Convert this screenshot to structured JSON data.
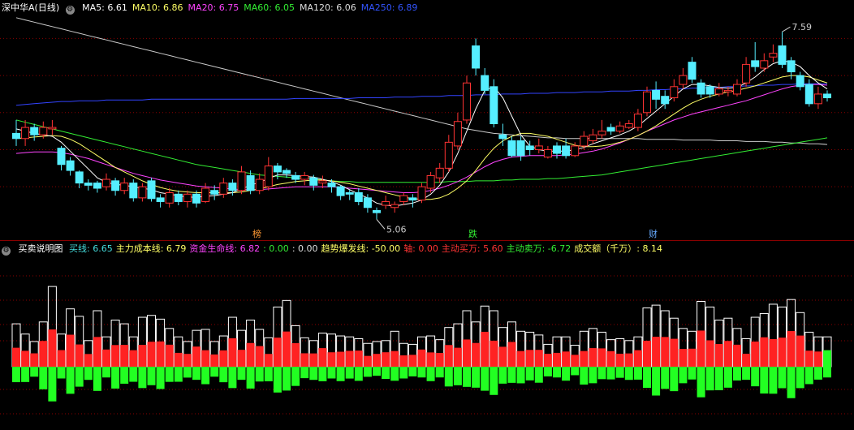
{
  "stock": {
    "title": "深中华A(日线)"
  },
  "ma_legend": [
    {
      "label": "MA5: 6.61",
      "color": "#ffffff"
    },
    {
      "label": "MA10: 6.86",
      "color": "#ffff66"
    },
    {
      "label": "MA20: 6.75",
      "color": "#ff44ff"
    },
    {
      "label": "MA60: 6.05",
      "color": "#33ee33"
    },
    {
      "label": "MA120: 6.06",
      "color": "#dddddd"
    },
    {
      "label": "MA250: 6.89",
      "color": "#3355ff"
    }
  ],
  "indicator": {
    "title": "买卖说明图",
    "items": [
      {
        "label": "买线: 6.65",
        "color": "#44dddd"
      },
      {
        "label": "主力成本线: 6.79",
        "color": "#ffff66"
      },
      {
        "label": "资金生命线: 6.82",
        "color": "#ff44ff"
      },
      {
        "label": ": 0.00",
        "color": "#33ee33"
      },
      {
        "label": ": 0.00",
        "color": "#dddddd"
      },
      {
        "label": "趋势爆发线: -50.00",
        "color": "#ffff66"
      },
      {
        "label": "轴: 0.00",
        "color": "#ff3333"
      },
      {
        "label": "主动买万: 5.60",
        "color": "#ff3333"
      },
      {
        "label": "主动卖万: -6.72",
        "color": "#33ee33"
      },
      {
        "label": "成交额（千万）: 8.14",
        "color": "#ffff66"
      }
    ]
  },
  "markers": [
    {
      "text": "榜",
      "color": "#ff9933"
    },
    {
      "text": "跌",
      "color": "#33ee33"
    },
    {
      "text": "财",
      "color": "#66aaff"
    }
  ],
  "colors": {
    "up": "#ff3333",
    "down": "#55eeff",
    "buy": "#ff2222",
    "sell": "#22ff22",
    "grid": "#8b0000"
  },
  "chart_data": [
    {
      "type": "candlestick",
      "annotations": [
        {
          "text": "7.59",
          "value": 7.59
        },
        {
          "text": "5.06",
          "value": 5.06
        }
      ],
      "ylim": [
        4.9,
        7.8
      ],
      "candles": [
        [
          6.22,
          6.15,
          6.4,
          6.05
        ],
        [
          6.15,
          6.3,
          6.4,
          6.05
        ],
        [
          6.3,
          6.2,
          6.35,
          6.12
        ],
        [
          6.2,
          6.3,
          6.38,
          6.15
        ],
        [
          6.28,
          6.3,
          6.4,
          6.2
        ],
        [
          6.02,
          5.8,
          6.05,
          5.72
        ],
        [
          5.85,
          5.72,
          5.9,
          5.65
        ],
        [
          5.7,
          5.55,
          5.72,
          5.48
        ],
        [
          5.55,
          5.52,
          5.6,
          5.45
        ],
        [
          5.55,
          5.48,
          5.58,
          5.42
        ],
        [
          5.5,
          5.6,
          5.68,
          5.45
        ],
        [
          5.58,
          5.45,
          5.62,
          5.38
        ],
        [
          5.45,
          5.55,
          5.62,
          5.4
        ],
        [
          5.55,
          5.35,
          5.6,
          5.3
        ],
        [
          5.35,
          5.5,
          5.55,
          5.3
        ],
        [
          5.58,
          5.34,
          5.62,
          5.3
        ],
        [
          5.35,
          5.3,
          5.4,
          5.22
        ],
        [
          5.28,
          5.42,
          5.48,
          5.22
        ],
        [
          5.4,
          5.3,
          5.45,
          5.25
        ],
        [
          5.3,
          5.4,
          5.45,
          5.22
        ],
        [
          5.4,
          5.28,
          5.45,
          5.22
        ],
        [
          5.3,
          5.48,
          5.55,
          5.28
        ],
        [
          5.45,
          5.4,
          5.52,
          5.32
        ],
        [
          5.4,
          5.55,
          5.62,
          5.35
        ],
        [
          5.55,
          5.45,
          5.6,
          5.38
        ],
        [
          5.45,
          5.7,
          5.78,
          5.4
        ],
        [
          5.65,
          5.45,
          5.72,
          5.4
        ],
        [
          5.45,
          5.6,
          5.68,
          5.4
        ],
        [
          5.5,
          5.78,
          5.9,
          5.45
        ],
        [
          5.78,
          5.7,
          5.82,
          5.6
        ],
        [
          5.72,
          5.68,
          5.75,
          5.62
        ],
        [
          5.65,
          5.6,
          5.7,
          5.55
        ],
        [
          5.6,
          5.65,
          5.7,
          5.52
        ],
        [
          5.62,
          5.52,
          5.66,
          5.45
        ],
        [
          5.55,
          5.58,
          5.65,
          5.48
        ],
        [
          5.55,
          5.5,
          5.6,
          5.42
        ],
        [
          5.5,
          5.38,
          5.52,
          5.32
        ],
        [
          5.42,
          5.4,
          5.46,
          5.32
        ],
        [
          5.42,
          5.3,
          5.48,
          5.25
        ],
        [
          5.35,
          5.22,
          5.4,
          5.15
        ],
        [
          5.18,
          5.15,
          5.22,
          5.06
        ],
        [
          5.25,
          5.3,
          5.38,
          5.2
        ],
        [
          5.22,
          5.26,
          5.3,
          5.15
        ],
        [
          5.3,
          5.38,
          5.42,
          5.25
        ],
        [
          5.35,
          5.32,
          5.4,
          5.22
        ],
        [
          5.32,
          5.5,
          5.55,
          5.28
        ],
        [
          5.48,
          5.65,
          5.7,
          5.42
        ],
        [
          5.62,
          5.75,
          5.82,
          5.55
        ],
        [
          5.75,
          6.1,
          6.2,
          5.7
        ],
        [
          6.05,
          6.38,
          6.5,
          6.0
        ],
        [
          6.4,
          6.9,
          7.0,
          6.35
        ],
        [
          7.4,
          7.1,
          7.5,
          7.0
        ],
        [
          7.0,
          6.8,
          7.1,
          6.75
        ],
        [
          6.85,
          6.35,
          6.95,
          6.3
        ],
        [
          6.2,
          6.15,
          6.35,
          6.05
        ],
        [
          6.12,
          5.92,
          6.18,
          5.9
        ],
        [
          6.12,
          5.92,
          6.18,
          5.85
        ],
        [
          6.05,
          6.0,
          6.12,
          5.92
        ],
        [
          6.0,
          6.05,
          6.15,
          5.95
        ],
        [
          5.9,
          6.0,
          6.05,
          5.88
        ],
        [
          6.05,
          5.95,
          6.1,
          5.88
        ],
        [
          6.05,
          5.92,
          6.15,
          5.88
        ],
        [
          5.92,
          6.05,
          6.1,
          5.9
        ],
        [
          6.05,
          6.18,
          6.25,
          6.0
        ],
        [
          6.12,
          6.2,
          6.28,
          6.08
        ],
        [
          6.2,
          6.25,
          6.4,
          6.15
        ],
        [
          6.3,
          6.25,
          6.35,
          6.2
        ],
        [
          6.25,
          6.32,
          6.38,
          6.22
        ],
        [
          6.3,
          6.35,
          6.4,
          6.28
        ],
        [
          6.3,
          6.48,
          6.55,
          6.25
        ],
        [
          6.5,
          6.78,
          6.85,
          6.45
        ],
        [
          6.8,
          6.68,
          6.92,
          6.55
        ],
        [
          6.72,
          6.62,
          6.8,
          6.55
        ],
        [
          6.7,
          6.85,
          6.95,
          6.65
        ],
        [
          6.88,
          7.0,
          7.1,
          6.82
        ],
        [
          7.18,
          6.95,
          7.25,
          6.9
        ],
        [
          6.9,
          6.75,
          6.95,
          6.7
        ],
        [
          6.85,
          6.75,
          6.88,
          6.7
        ],
        [
          6.75,
          6.82,
          6.9,
          6.72
        ],
        [
          6.78,
          6.8,
          6.85,
          6.72
        ],
        [
          6.75,
          6.88,
          6.95,
          6.72
        ],
        [
          6.9,
          7.15,
          7.25,
          6.85
        ],
        [
          7.2,
          7.12,
          7.45,
          7.05
        ],
        [
          7.1,
          7.2,
          7.3,
          7.05
        ],
        [
          7.25,
          7.3,
          7.42,
          7.18
        ],
        [
          7.4,
          7.15,
          7.59,
          7.1
        ],
        [
          7.2,
          7.05,
          7.25,
          6.95
        ],
        [
          7.0,
          6.85,
          7.05,
          6.8
        ],
        [
          6.88,
          6.62,
          6.95,
          6.58
        ],
        [
          6.62,
          6.75,
          6.85,
          6.55
        ],
        [
          6.75,
          6.7,
          6.8,
          6.65
        ]
      ],
      "ma": {
        "MA5": [
          6.28,
          6.25,
          6.22,
          6.2,
          6.18,
          6.1,
          5.98,
          5.86,
          5.74,
          5.62,
          5.56,
          5.53,
          5.52,
          5.5,
          5.48,
          5.46,
          5.42,
          5.4,
          5.38,
          5.36,
          5.36,
          5.37,
          5.38,
          5.4,
          5.42,
          5.47,
          5.52,
          5.56,
          5.61,
          5.66,
          5.66,
          5.65,
          5.64,
          5.63,
          5.6,
          5.57,
          5.52,
          5.46,
          5.4,
          5.35,
          5.28,
          5.25,
          5.24,
          5.26,
          5.28,
          5.32,
          5.4,
          5.52,
          5.7,
          5.95,
          6.25,
          6.55,
          6.8,
          6.85,
          6.7,
          6.45,
          6.2,
          6.05,
          6.0,
          5.98,
          5.98,
          5.98,
          6.0,
          6.03,
          6.08,
          6.12,
          6.16,
          6.2,
          6.25,
          6.32,
          6.42,
          6.52,
          6.62,
          6.72,
          6.82,
          6.88,
          6.88,
          6.86,
          6.84,
          6.83,
          6.84,
          6.9,
          6.98,
          7.08,
          7.16,
          7.2,
          7.18,
          7.12,
          7.0,
          6.9,
          6.82
        ],
        "MA10": [
          6.15,
          6.16,
          6.17,
          6.18,
          6.19,
          6.18,
          6.14,
          6.08,
          6.0,
          5.92,
          5.84,
          5.76,
          5.7,
          5.64,
          5.58,
          5.53,
          5.49,
          5.46,
          5.44,
          5.43,
          5.42,
          5.42,
          5.42,
          5.42,
          5.42,
          5.43,
          5.45,
          5.47,
          5.5,
          5.53,
          5.55,
          5.57,
          5.58,
          5.59,
          5.59,
          5.58,
          5.56,
          5.54,
          5.51,
          5.48,
          5.45,
          5.42,
          5.39,
          5.36,
          5.34,
          5.33,
          5.33,
          5.35,
          5.4,
          5.48,
          5.58,
          5.72,
          5.88,
          6.02,
          6.12,
          6.18,
          6.22,
          6.22,
          6.2,
          6.18,
          6.14,
          6.1,
          6.06,
          6.04,
          6.04,
          6.05,
          6.07,
          6.1,
          6.14,
          6.19,
          6.25,
          6.32,
          6.4,
          6.48,
          6.56,
          6.63,
          6.68,
          6.72,
          6.75,
          6.78,
          6.8,
          6.83,
          6.86,
          6.9,
          6.94,
          6.98,
          7.0,
          7.0,
          6.98,
          6.94,
          6.9
        ],
        "MA20": [
          5.95,
          5.96,
          5.97,
          5.97,
          5.97,
          5.96,
          5.94,
          5.91,
          5.88,
          5.84,
          5.8,
          5.76,
          5.72,
          5.68,
          5.65,
          5.62,
          5.59,
          5.57,
          5.55,
          5.53,
          5.51,
          5.5,
          5.49,
          5.48,
          5.47,
          5.46,
          5.46,
          5.46,
          5.47,
          5.48,
          5.49,
          5.5,
          5.5,
          5.5,
          5.5,
          5.5,
          5.49,
          5.48,
          5.47,
          5.46,
          5.45,
          5.44,
          5.43,
          5.42,
          5.42,
          5.43,
          5.45,
          5.48,
          5.52,
          5.57,
          5.63,
          5.7,
          5.77,
          5.83,
          5.87,
          5.9,
          5.91,
          5.92,
          5.92,
          5.92,
          5.92,
          5.93,
          5.94,
          5.96,
          5.98,
          6.01,
          6.05,
          6.09,
          6.14,
          6.19,
          6.25,
          6.3,
          6.35,
          6.4,
          6.44,
          6.48,
          6.51,
          6.54,
          6.57,
          6.6,
          6.63,
          6.66,
          6.7,
          6.74,
          6.78,
          6.82,
          6.85,
          6.87,
          6.88,
          6.88,
          6.87
        ],
        "MA60": [
          6.4,
          6.37,
          6.34,
          6.31,
          6.28,
          6.25,
          6.22,
          6.19,
          6.16,
          6.13,
          6.1,
          6.07,
          6.04,
          6.01,
          5.98,
          5.95,
          5.92,
          5.89,
          5.86,
          5.83,
          5.8,
          5.78,
          5.76,
          5.74,
          5.72,
          5.7,
          5.68,
          5.66,
          5.65,
          5.64,
          5.63,
          5.62,
          5.61,
          5.6,
          5.59,
          5.58,
          5.57,
          5.57,
          5.56,
          5.56,
          5.56,
          5.56,
          5.56,
          5.56,
          5.56,
          5.56,
          5.56,
          5.56,
          5.57,
          5.57,
          5.57,
          5.58,
          5.58,
          5.58,
          5.59,
          5.59,
          5.6,
          5.6,
          5.6,
          5.61,
          5.61,
          5.62,
          5.63,
          5.64,
          5.65,
          5.66,
          5.68,
          5.7,
          5.72,
          5.74,
          5.76,
          5.78,
          5.8,
          5.82,
          5.84,
          5.86,
          5.88,
          5.9,
          5.92,
          5.94,
          5.96,
          5.98,
          6.0,
          6.02,
          6.04,
          6.06,
          6.08,
          6.1,
          6.12,
          6.14,
          6.16
        ],
        "MA120": [
          7.78,
          7.75,
          7.72,
          7.69,
          7.66,
          7.63,
          7.6,
          7.57,
          7.54,
          7.51,
          7.48,
          7.45,
          7.42,
          7.39,
          7.36,
          7.33,
          7.3,
          7.27,
          7.24,
          7.21,
          7.18,
          7.15,
          7.12,
          7.09,
          7.06,
          7.03,
          7.0,
          6.97,
          6.94,
          6.91,
          6.88,
          6.85,
          6.82,
          6.79,
          6.76,
          6.73,
          6.7,
          6.67,
          6.64,
          6.61,
          6.58,
          6.55,
          6.52,
          6.49,
          6.46,
          6.43,
          6.4,
          6.37,
          6.34,
          6.31,
          6.28,
          6.26,
          6.24,
          6.22,
          6.21,
          6.2,
          6.19,
          6.18,
          6.17,
          6.16,
          6.16,
          6.15,
          6.15,
          6.15,
          6.15,
          6.15,
          6.15,
          6.15,
          6.15,
          6.15,
          6.14,
          6.14,
          6.14,
          6.14,
          6.13,
          6.13,
          6.13,
          6.13,
          6.12,
          6.12,
          6.12,
          6.11,
          6.11,
          6.11,
          6.1,
          6.1,
          6.09,
          6.09,
          6.08,
          6.08,
          6.07
        ],
        "MA250": [
          6.6,
          6.61,
          6.62,
          6.63,
          6.64,
          6.65,
          6.65,
          6.66,
          6.66,
          6.66,
          6.67,
          6.67,
          6.67,
          6.67,
          6.67,
          6.68,
          6.68,
          6.68,
          6.68,
          6.68,
          6.68,
          6.68,
          6.68,
          6.68,
          6.68,
          6.68,
          6.68,
          6.68,
          6.68,
          6.68,
          6.68,
          6.69,
          6.69,
          6.69,
          6.69,
          6.69,
          6.69,
          6.69,
          6.7,
          6.7,
          6.7,
          6.7,
          6.71,
          6.71,
          6.71,
          6.72,
          6.72,
          6.72,
          6.73,
          6.73,
          6.73,
          6.74,
          6.74,
          6.74,
          6.75,
          6.75,
          6.75,
          6.76,
          6.76,
          6.76,
          6.77,
          6.77,
          6.77,
          6.78,
          6.78,
          6.78,
          6.79,
          6.79,
          6.79,
          6.8,
          6.8,
          6.81,
          6.81,
          6.82,
          6.82,
          6.83,
          6.83,
          6.84,
          6.84,
          6.85,
          6.85,
          6.86,
          6.86,
          6.87,
          6.87,
          6.88,
          6.88,
          6.89,
          6.89,
          6.89,
          6.89
        ]
      }
    },
    {
      "type": "bar",
      "ylim": [
        -1,
        1
      ],
      "total": [
        0.46,
        0.35,
        0.27,
        0.48,
        0.86,
        0.35,
        0.62,
        0.54,
        0.28,
        0.6,
        0.32,
        0.5,
        0.46,
        0.32,
        0.53,
        0.55,
        0.51,
        0.41,
        0.32,
        0.27,
        0.39,
        0.4,
        0.27,
        0.33,
        0.53,
        0.39,
        0.5,
        0.4,
        0.31,
        0.64,
        0.71,
        0.44,
        0.31,
        0.28,
        0.36,
        0.35,
        0.33,
        0.32,
        0.3,
        0.25,
        0.27,
        0.28,
        0.38,
        0.25,
        0.24,
        0.32,
        0.33,
        0.29,
        0.42,
        0.46,
        0.6,
        0.48,
        0.65,
        0.6,
        0.42,
        0.48,
        0.38,
        0.37,
        0.34,
        0.24,
        0.32,
        0.32,
        0.23,
        0.38,
        0.41,
        0.37,
        0.29,
        0.3,
        0.28,
        0.32,
        0.63,
        0.66,
        0.6,
        0.52,
        0.41,
        0.38,
        0.7,
        0.64,
        0.5,
        0.52,
        0.41,
        0.3,
        0.53,
        0.57,
        0.67,
        0.64,
        0.72,
        0.58,
        0.37,
        0.32,
        0.32
      ]
    }
  ]
}
